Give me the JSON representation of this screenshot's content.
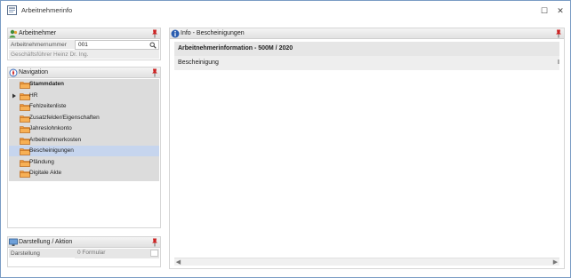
{
  "window": {
    "title": "Arbeitnehmerinfo",
    "maximize_glyph": "☐",
    "close_glyph": "✕"
  },
  "employee_panel": {
    "title": "Arbeitnehmer",
    "label": "Arbeitnehmernummer",
    "value": "001",
    "name_line": "Geschäftsführer Heinz Dr. Ing."
  },
  "navigation": {
    "title": "Navigation",
    "items": [
      {
        "label": "Stammdaten",
        "bold": true,
        "selected": false,
        "expandable": false
      },
      {
        "label": "HR",
        "bold": false,
        "selected": false,
        "expandable": true
      },
      {
        "label": "Fehlzeitenliste",
        "bold": false,
        "selected": false,
        "expandable": false
      },
      {
        "label": "Zusatzfelder/Eigenschaften",
        "bold": false,
        "selected": false,
        "expandable": false
      },
      {
        "label": "Jahreslohnkonto",
        "bold": false,
        "selected": false,
        "expandable": false
      },
      {
        "label": "Arbeitnehmerkosten",
        "bold": false,
        "selected": false,
        "expandable": false
      },
      {
        "label": "Bescheinigungen",
        "bold": false,
        "selected": true,
        "expandable": false
      },
      {
        "label": "Pfändung",
        "bold": false,
        "selected": false,
        "expandable": false
      },
      {
        "label": "Digitale Akte",
        "bold": false,
        "selected": false,
        "expandable": false
      }
    ]
  },
  "display_panel": {
    "title": "Darstellung / Aktion",
    "label": "Darstellung",
    "value": "0 Formular"
  },
  "info_panel": {
    "title": "Info - Bescheinigungen",
    "section_title": "Arbeitnehmerinformation - 500M / 2020",
    "row_label": "Bescheinigung",
    "row_edge": "I",
    "scroll_left": "◀",
    "scroll_right": "▶"
  },
  "colors": {
    "selection": "#c6d5ee",
    "folder": "#f29a3c",
    "pin": "#cc2222",
    "info_icon": "#2a5db0"
  }
}
